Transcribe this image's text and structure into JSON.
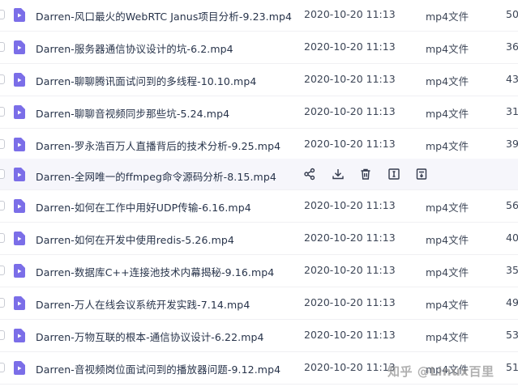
{
  "files": [
    {
      "name": "Darren-风口最火的WebRTC Janus项目分析-9.23.mp4",
      "date": "2020-10-20 11:13",
      "type": "mp4文件",
      "size": "50"
    },
    {
      "name": "Darren-服务器通信协议设计的坑-6.2.mp4",
      "date": "2020-10-20 11:13",
      "type": "mp4文件",
      "size": "36"
    },
    {
      "name": "Darren-聊聊腾讯面试问到的多线程-10.10.mp4",
      "date": "2020-10-20 11:13",
      "type": "mp4文件",
      "size": "43"
    },
    {
      "name": "Darren-聊聊音视频同步那些坑-5.24.mp4",
      "date": "2020-10-20 11:13",
      "type": "mp4文件",
      "size": "31"
    },
    {
      "name": "Darren-罗永浩百万人直播背后的技术分析-9.25.mp4",
      "date": "2020-10-20 11:13",
      "type": "mp4文件",
      "size": "39"
    },
    {
      "name": "Darren-全网唯一的ffmpeg命令源码分析-8.15.mp4",
      "date": "",
      "type": "",
      "size": ""
    },
    {
      "name": "Darren-如何在工作中用好UDP传输-6.16.mp4",
      "date": "2020-10-20 11:13",
      "type": "mp4文件",
      "size": "56"
    },
    {
      "name": "Darren-如何在开发中使用redis-5.26.mp4",
      "date": "2020-10-20 11:13",
      "type": "mp4文件",
      "size": "40"
    },
    {
      "name": "Darren-数据库C++连接池技术内幕揭秘-9.16.mp4",
      "date": "2020-10-20 11:13",
      "type": "mp4文件",
      "size": "35"
    },
    {
      "name": "Darren-万人在线会议系统开发实践-7.14.mp4",
      "date": "2020-10-20 11:13",
      "type": "mp4文件",
      "size": "49"
    },
    {
      "name": "Darren-万物互联的根本-通信协议设计-6.22.mp4",
      "date": "2020-10-20 11:13",
      "type": "mp4文件",
      "size": "53"
    },
    {
      "name": "Darren-音视频岗位面试问到的播放器问题-9.12.mp4",
      "date": "2020-10-20 11:13",
      "type": "mp4文件",
      "size": "51"
    }
  ],
  "hover_actions": [
    "share-icon",
    "download-icon",
    "delete-icon",
    "rename-icon",
    "move-icon"
  ],
  "watermark": "知乎 @Linux百里",
  "colors": {
    "file_icon": "#7b6ee8",
    "hover_bg": "#f6f6fb",
    "action_icon": "#333a4d"
  }
}
